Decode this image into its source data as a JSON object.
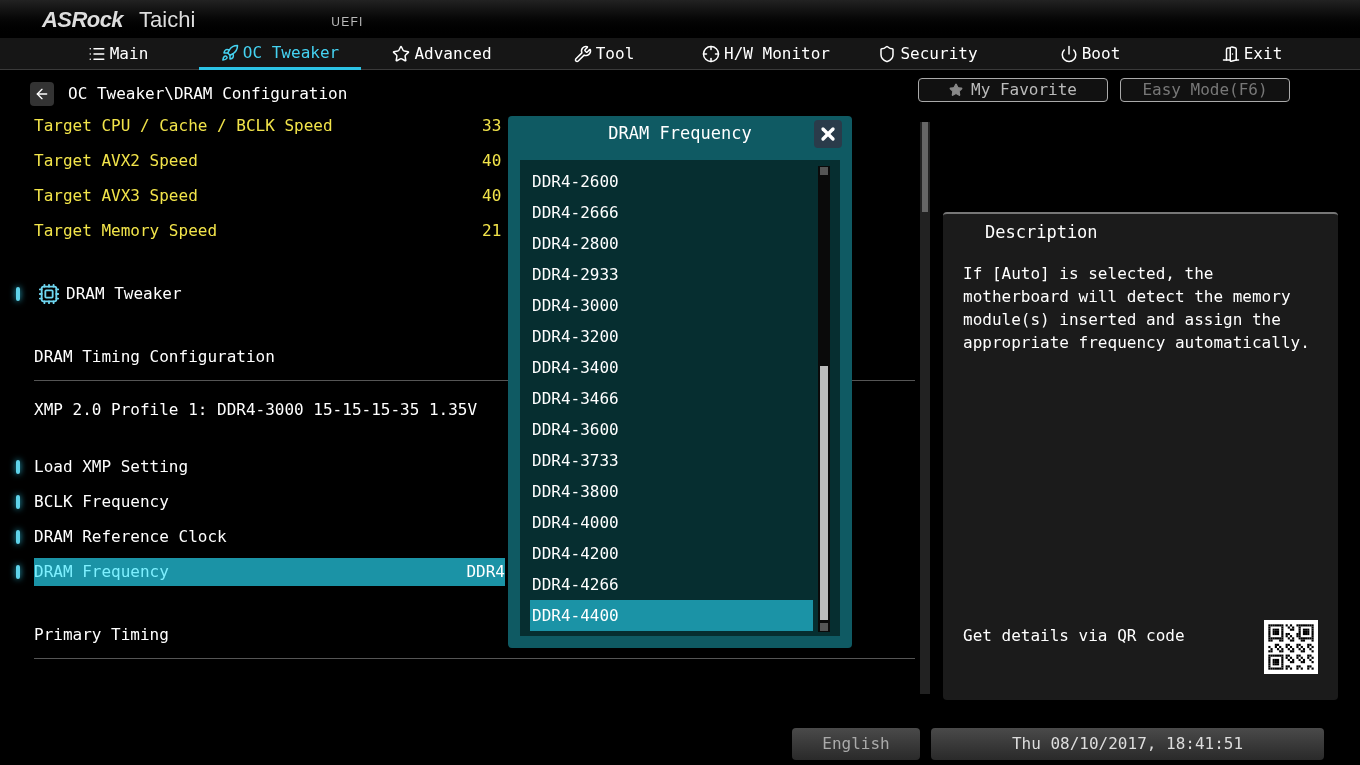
{
  "header": {
    "brand": "ASRock",
    "model": "Taichi",
    "firmware": "UEFI"
  },
  "tabs": [
    {
      "label": "Main",
      "selected": false
    },
    {
      "label": "OC Tweaker",
      "selected": true
    },
    {
      "label": "Advanced",
      "selected": false
    },
    {
      "label": "Tool",
      "selected": false
    },
    {
      "label": "H/W Monitor",
      "selected": false
    },
    {
      "label": "Security",
      "selected": false
    },
    {
      "label": "Boot",
      "selected": false
    },
    {
      "label": "Exit",
      "selected": false
    }
  ],
  "breadcrumb": "OC Tweaker\\DRAM Configuration",
  "items": [
    {
      "kind": "info",
      "label": "Target CPU / Cache / BCLK Speed",
      "value": "33"
    },
    {
      "kind": "info",
      "label": "Target AVX2 Speed",
      "value": "40"
    },
    {
      "kind": "info",
      "label": "Target AVX3 Speed",
      "value": "40"
    },
    {
      "kind": "info",
      "label": "Target Memory Speed",
      "value": "21"
    },
    {
      "kind": "submenu",
      "label": "DRAM Tweaker"
    },
    {
      "kind": "section",
      "label": "DRAM Timing Configuration"
    },
    {
      "kind": "text",
      "label": "XMP 2.0 Profile 1: DDR4-3000 15-15-15-35 1.35V"
    },
    {
      "kind": "option",
      "label": "Load XMP Setting",
      "selected": false
    },
    {
      "kind": "option",
      "label": "BCLK Frequency",
      "selected": false
    },
    {
      "kind": "option",
      "label": "DRAM Reference Clock",
      "selected": false
    },
    {
      "kind": "option",
      "label": "DRAM Frequency",
      "value": "DDR4",
      "selected": true
    },
    {
      "kind": "section",
      "label": "Primary Timing"
    }
  ],
  "favorite_button": "My Favorite",
  "easy_mode_button": "Easy Mode(F6)",
  "description": {
    "title": "Description",
    "text": "If [Auto] is selected, the motherboard will detect the memory module(s) inserted and assign the appropriate frequency automatically.",
    "qr_hint": "Get details via QR code"
  },
  "language": "English",
  "datetime": "Thu 08/10/2017, 18:41:51",
  "dialog": {
    "title": "DRAM Frequency",
    "options": [
      {
        "label": "DDR4-2600",
        "selected": false
      },
      {
        "label": "DDR4-2666",
        "selected": false
      },
      {
        "label": "DDR4-2800",
        "selected": false
      },
      {
        "label": "DDR4-2933",
        "selected": false
      },
      {
        "label": "DDR4-3000",
        "selected": false
      },
      {
        "label": "DDR4-3200",
        "selected": false
      },
      {
        "label": "DDR4-3400",
        "selected": false
      },
      {
        "label": "DDR4-3466",
        "selected": false
      },
      {
        "label": "DDR4-3600",
        "selected": false
      },
      {
        "label": "DDR4-3733",
        "selected": false
      },
      {
        "label": "DDR4-3800",
        "selected": false
      },
      {
        "label": "DDR4-4000",
        "selected": false
      },
      {
        "label": "DDR4-4200",
        "selected": false
      },
      {
        "label": "DDR4-4266",
        "selected": false
      },
      {
        "label": "DDR4-4400",
        "selected": true
      }
    ]
  }
}
